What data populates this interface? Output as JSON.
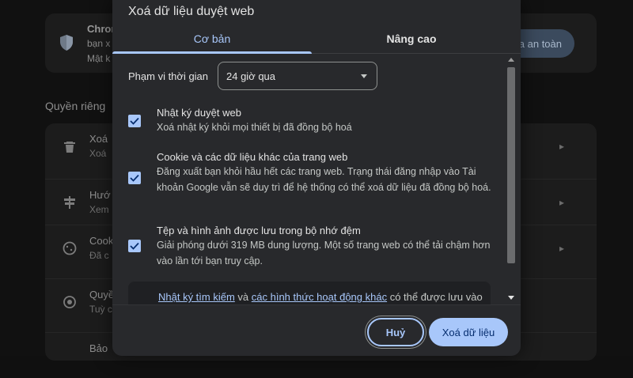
{
  "background": {
    "card": {
      "title": "Chron",
      "line1": "bạn x",
      "line2": "Mật k",
      "safe_button": "a an toàn",
      "icon": "shield-icon"
    },
    "section_title": "Quyền riêng",
    "rows": [
      {
        "icon": "trash-icon",
        "t1": "Xoá",
        "t2": "Xoá"
      },
      {
        "icon": "guide-icon",
        "t1": "Hướ",
        "t2": "Xem"
      },
      {
        "icon": "cookie-icon",
        "t1": "Cook",
        "t2": "Đã c"
      },
      {
        "icon": "permissions-icon",
        "t1": "Quyề",
        "t2": "Tuỳ c"
      },
      {
        "icon": "security-icon",
        "t1": "Bảo",
        "t2": ""
      }
    ]
  },
  "dialog": {
    "title": "Xoá dữ liệu duyệt web",
    "tabs": [
      {
        "label": "Cơ bản",
        "active": true
      },
      {
        "label": "Nâng cao",
        "active": false
      }
    ],
    "time_range": {
      "label": "Phạm vi thời gian",
      "value": "24 giờ qua"
    },
    "options": [
      {
        "title": "Nhật ký duyệt web",
        "desc": "Xoá nhật ký khỏi mọi thiết bị đã đồng bộ hoá",
        "checked": true
      },
      {
        "title": "Cookie và các dữ liệu khác của trang web",
        "desc": "Đăng xuất bạn khỏi hầu hết các trang web. Trạng thái đăng nhập vào Tài khoản Google vẫn sẽ duy trì để hệ thống có thể xoá dữ liệu đã đồng bộ hoá.",
        "checked": true
      },
      {
        "title": "Tệp và hình ảnh được lưu trong bộ nhớ đệm",
        "desc": "Giải phóng dưới 319 MB dung lượng. Một số trang web có thể tải chậm hơn vào lần tới bạn truy cập.",
        "checked": true
      }
    ],
    "info": {
      "link1": "Nhật ký tìm kiếm",
      "connector": " và ",
      "link2": "các hình thức hoạt động khác",
      "suffix": " có thể được lưu vào"
    },
    "buttons": {
      "cancel": "Huỷ",
      "clear": "Xoá dữ liệu"
    },
    "colors": {
      "accent": "#a8c7fa",
      "dialog_bg": "#28292c"
    }
  }
}
